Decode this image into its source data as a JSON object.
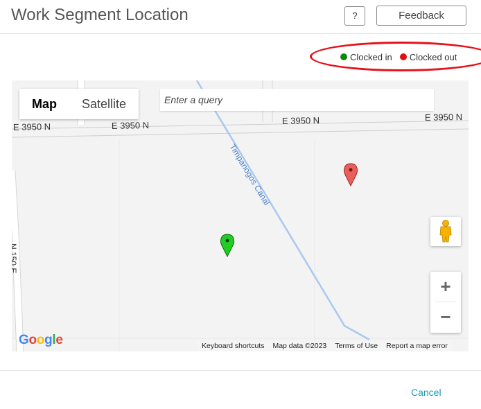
{
  "header": {
    "title": "Work Segment Location",
    "help_label": "?",
    "feedback_label": "Feedback"
  },
  "legend": {
    "items": [
      {
        "label": "Clocked in",
        "color": "#0a8a0a"
      },
      {
        "label": "Clocked out",
        "color": "#e30d0d"
      }
    ]
  },
  "map": {
    "type_tabs": [
      "Map",
      "Satellite"
    ],
    "active_tab": "Map",
    "query_placeholder": "Enter a query",
    "road_labels": {
      "road_left": "E 3950 N",
      "road_mid": "E 3950 N",
      "road_center": "E 3950 N",
      "road_right": "E 3950 N",
      "canal": "Timpanogos Canal",
      "vertical_road": "N 150 E"
    },
    "zoom_in_label": "+",
    "zoom_out_label": "−",
    "footer": {
      "keyboard": "Keyboard shortcuts",
      "data": "Map data ©2023",
      "terms": "Terms of Use",
      "report": "Report a map error"
    },
    "logo": "Google",
    "markers": [
      {
        "status": "clocked-in",
        "color": "#22cc22"
      },
      {
        "status": "clocked-out",
        "color": "#e8605a"
      }
    ]
  },
  "actions": {
    "cancel_label": "Cancel"
  }
}
